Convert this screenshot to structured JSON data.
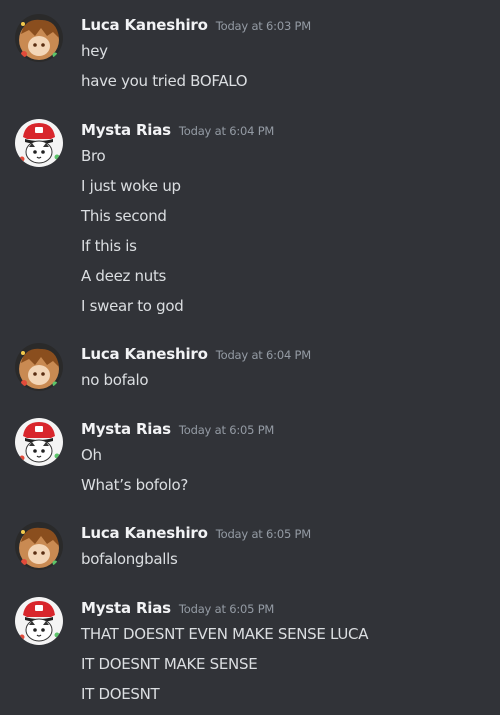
{
  "messages": [
    {
      "author": "Luca Kaneshiro",
      "timestamp": "Today at 6:03 PM",
      "avatar_icon": "luca-avatar",
      "lines": [
        "hey",
        "have you tried BOFALO"
      ]
    },
    {
      "author": "Mysta Rias",
      "timestamp": "Today at 6:04 PM",
      "avatar_icon": "mysta-avatar",
      "lines": [
        "Bro",
        "I just woke up",
        "This second",
        "If this is",
        "A deez nuts",
        "I swear to god"
      ]
    },
    {
      "author": "Luca Kaneshiro",
      "timestamp": "Today at 6:04 PM",
      "avatar_icon": "luca-avatar",
      "lines": [
        "no bofalo"
      ]
    },
    {
      "author": "Mysta Rias",
      "timestamp": "Today at 6:05 PM",
      "avatar_icon": "mysta-avatar",
      "lines": [
        "Oh",
        "What’s bofolo?"
      ]
    },
    {
      "author": "Luca Kaneshiro",
      "timestamp": "Today at 6:05 PM",
      "avatar_icon": "luca-avatar",
      "lines": [
        "bofalongballs"
      ]
    },
    {
      "author": "Mysta Rias",
      "timestamp": "Today at 6:05 PM",
      "avatar_icon": "mysta-avatar",
      "lines": [
        "THAT DOESNT EVEN MAKE SENSE LUCA",
        "IT DOESNT MAKE SENSE",
        "IT DOESNT"
      ]
    }
  ],
  "colors": {
    "background": "#313338",
    "username": "#f2f3f5",
    "timestamp": "#949ba4",
    "text": "#dbdee1"
  }
}
